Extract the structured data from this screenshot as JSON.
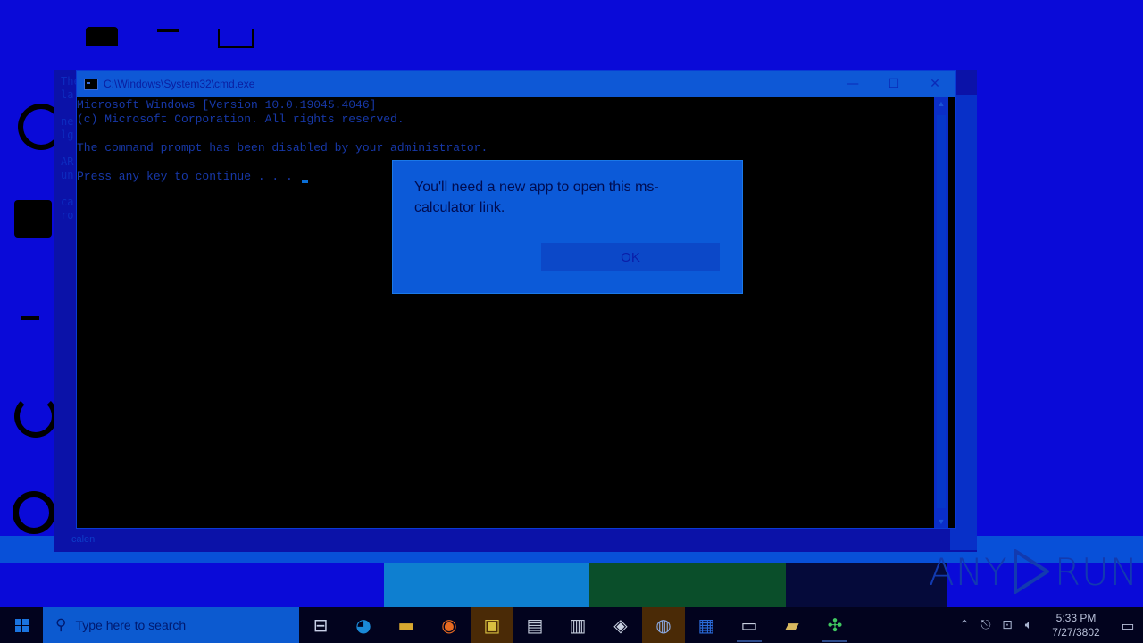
{
  "cmd_window": {
    "title": "C:\\Windows\\System32\\cmd.exe",
    "controls": {
      "minimize": "—",
      "maximize": "☐",
      "close": "✕"
    },
    "lines": [
      "Microsoft Windows [Version 10.0.19045.4046]",
      "(c) Microsoft Corporation. All rights reserved.",
      "",
      "The command prompt has been disabled by your administrator.",
      "",
      "Press any key to continue . . . "
    ]
  },
  "background_window": {
    "fragments": "The\nla\n\nne\nlg\n\nAR\nun\n\nca\nro",
    "bottom_label": "calen"
  },
  "dialog": {
    "message": "You'll need a new app to open this ms-calculator link.",
    "ok_label": "OK"
  },
  "watermark": {
    "left": "ANY",
    "right": "RUN"
  },
  "taskbar": {
    "search_placeholder": "Type here to search",
    "apps": [
      {
        "name": "task-view-icon",
        "glyph": "⊟"
      },
      {
        "name": "edge-icon",
        "glyph": "◕"
      },
      {
        "name": "file-explorer-icon",
        "glyph": "▬"
      },
      {
        "name": "firefox-icon",
        "glyph": "◉"
      },
      {
        "name": "archive-tool-icon",
        "glyph": "▣"
      },
      {
        "name": "document-app-icon",
        "glyph": "▤"
      },
      {
        "name": "window-app-icon",
        "glyph": "▥"
      },
      {
        "name": "cube-app-icon",
        "glyph": "◈"
      },
      {
        "name": "user-app-icon",
        "glyph": "◍"
      },
      {
        "name": "word-app-icon",
        "glyph": "▦"
      },
      {
        "name": "cmd-icon",
        "glyph": "▭"
      },
      {
        "name": "printer-icon",
        "glyph": "▰"
      },
      {
        "name": "network-tool-icon",
        "glyph": "✣"
      }
    ],
    "clock_time": "5:33 PM",
    "clock_date": "7/27/3802"
  },
  "colors": {
    "desktop": "#0a0ad8",
    "accent": "#0e58d6",
    "taskbar": "#02031e"
  }
}
